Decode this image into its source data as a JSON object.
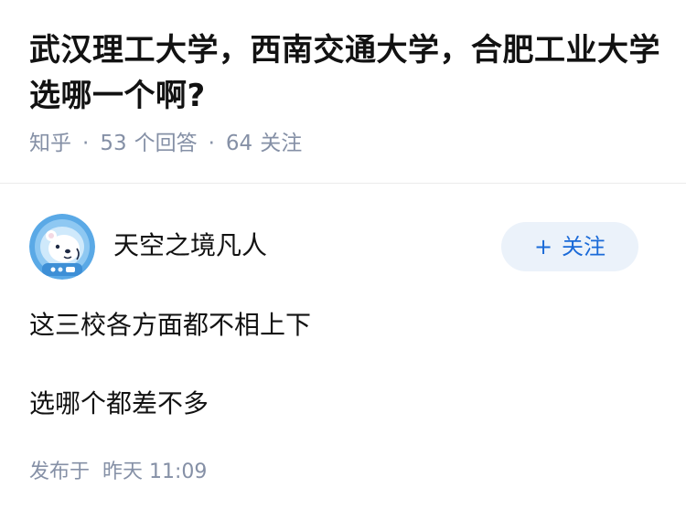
{
  "question": {
    "title": "武汉理工大学，西南交通大学，合肥工业大学选哪一个啊?",
    "source": "知乎",
    "separator": "·",
    "answer_count": "53",
    "answer_count_label": "个回答",
    "follower_count": "64",
    "follower_count_label": "关注"
  },
  "author": {
    "name": "天空之境凡人",
    "avatar_icon": "astronaut-bear-avatar",
    "follow_plus": "+",
    "follow_label": "关注"
  },
  "answer": {
    "paragraphs": [
      "这三校各方面都不相上下",
      "选哪个都差不多"
    ]
  },
  "footer": {
    "published_label": "发布于",
    "published_time": "昨天 11:09"
  },
  "colors": {
    "text_primary": "#121212",
    "text_secondary": "#8590a6",
    "accent": "#1a6ad8",
    "follow_bg": "#ebf2fa",
    "avatar_bg": "#5aa9e6"
  }
}
